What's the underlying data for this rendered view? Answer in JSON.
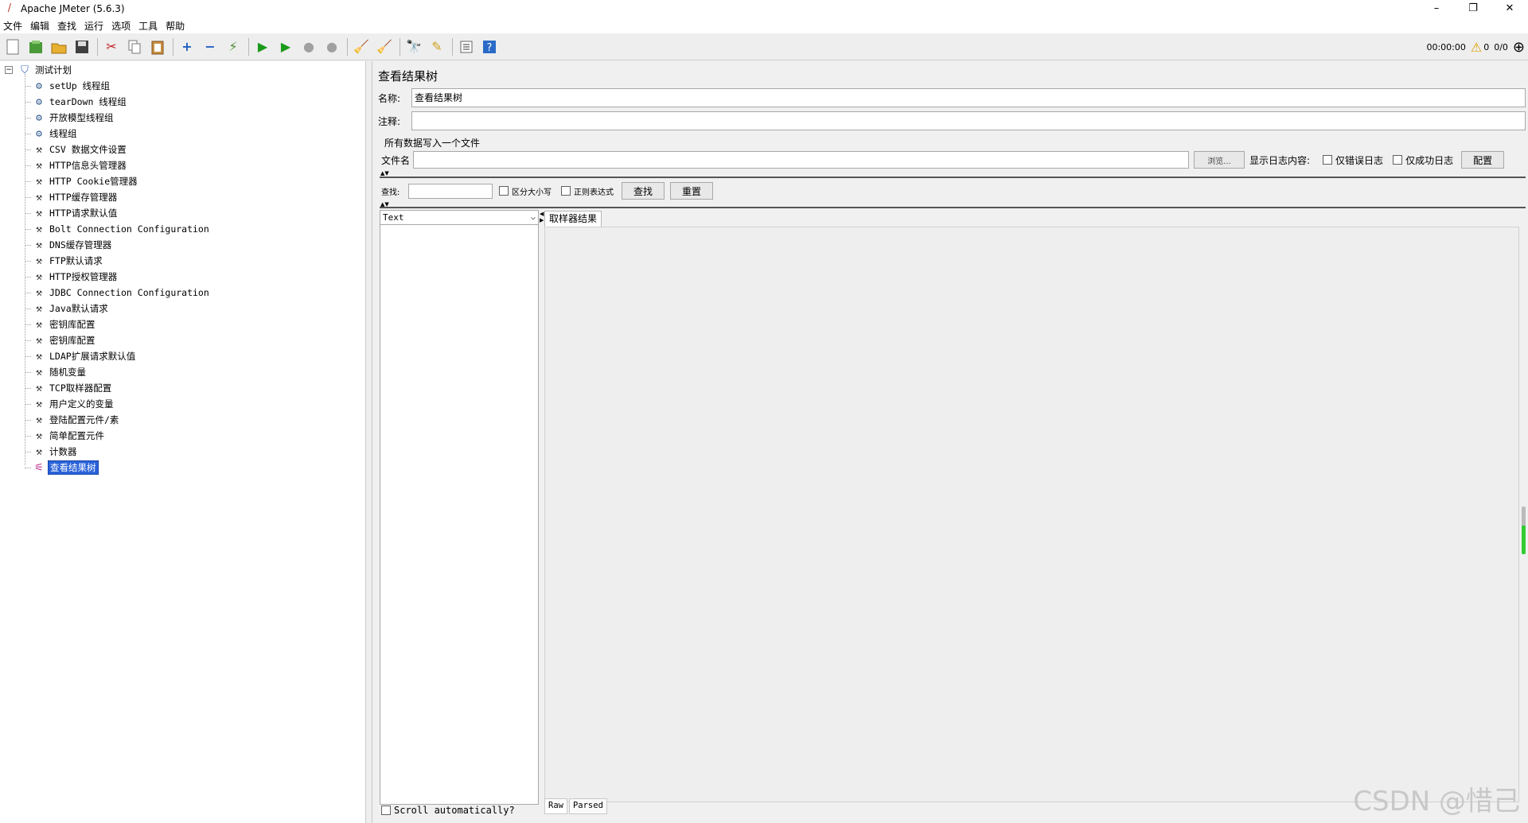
{
  "window": {
    "title": "Apache JMeter (5.6.3)",
    "minimize": "–",
    "maximize": "❐",
    "close": "✕"
  },
  "menu": [
    "文件",
    "编辑",
    "查找",
    "运行",
    "选项",
    "工具",
    "帮助"
  ],
  "toolbar": {
    "timer": "00:00:00",
    "warning_count": "0",
    "threads": "0/0"
  },
  "tree": {
    "root": "测试计划",
    "items": [
      {
        "label": "setUp 线程组",
        "icon": "gear-icon"
      },
      {
        "label": "tearDown 线程组",
        "icon": "gear-icon"
      },
      {
        "label": "开放模型线程组",
        "icon": "gear-icon"
      },
      {
        "label": "线程组",
        "icon": "gear-icon"
      },
      {
        "label": "CSV 数据文件设置",
        "icon": "wrench-icon"
      },
      {
        "label": "HTTP信息头管理器",
        "icon": "wrench-icon"
      },
      {
        "label": "HTTP Cookie管理器",
        "icon": "wrench-icon"
      },
      {
        "label": "HTTP缓存管理器",
        "icon": "wrench-icon"
      },
      {
        "label": "HTTP请求默认值",
        "icon": "wrench-icon"
      },
      {
        "label": "Bolt Connection Configuration",
        "icon": "wrench-icon"
      },
      {
        "label": "DNS缓存管理器",
        "icon": "wrench-icon"
      },
      {
        "label": "FTP默认请求",
        "icon": "wrench-icon"
      },
      {
        "label": "HTTP授权管理器",
        "icon": "wrench-icon"
      },
      {
        "label": "JDBC Connection Configuration",
        "icon": "wrench-icon"
      },
      {
        "label": "Java默认请求",
        "icon": "wrench-icon"
      },
      {
        "label": "密钥库配置",
        "icon": "wrench-icon"
      },
      {
        "label": "密钥库配置",
        "icon": "wrench-icon"
      },
      {
        "label": "LDAP扩展请求默认值",
        "icon": "wrench-icon"
      },
      {
        "label": "随机变量",
        "icon": "wrench-icon"
      },
      {
        "label": "TCP取样器配置",
        "icon": "wrench-icon"
      },
      {
        "label": "用户定义的变量",
        "icon": "wrench-icon"
      },
      {
        "label": "登陆配置元件/素",
        "icon": "wrench-icon"
      },
      {
        "label": "简单配置元件",
        "icon": "wrench-icon"
      },
      {
        "label": "计数器",
        "icon": "wrench-icon"
      },
      {
        "label": "查看结果树",
        "icon": "chart-icon",
        "selected": true
      }
    ]
  },
  "panel": {
    "title": "查看结果树",
    "name_label": "名称:",
    "name_value": "查看结果树",
    "comment_label": "注释:",
    "comment_value": "",
    "file_group_label": "所有数据写入一个文件",
    "filename_label": "文件名",
    "filename_value": "",
    "browse_button": "浏览...",
    "log_display_label": "显示日志内容:",
    "errors_only": "仅错误日志",
    "success_only": "仅成功日志",
    "configure_button": "配置",
    "search_label": "查找:",
    "search_value": "",
    "case_sensitive": "区分大小写",
    "regex": "正则表达式",
    "find_button": "查找",
    "reset_button": "重置",
    "renderer_selected": "Text",
    "scroll_auto": "Scroll automatically?",
    "result_tab": "取样器结果",
    "bottom_tabs": [
      "Raw",
      "Parsed"
    ]
  },
  "watermark": "CSDN @惜己"
}
